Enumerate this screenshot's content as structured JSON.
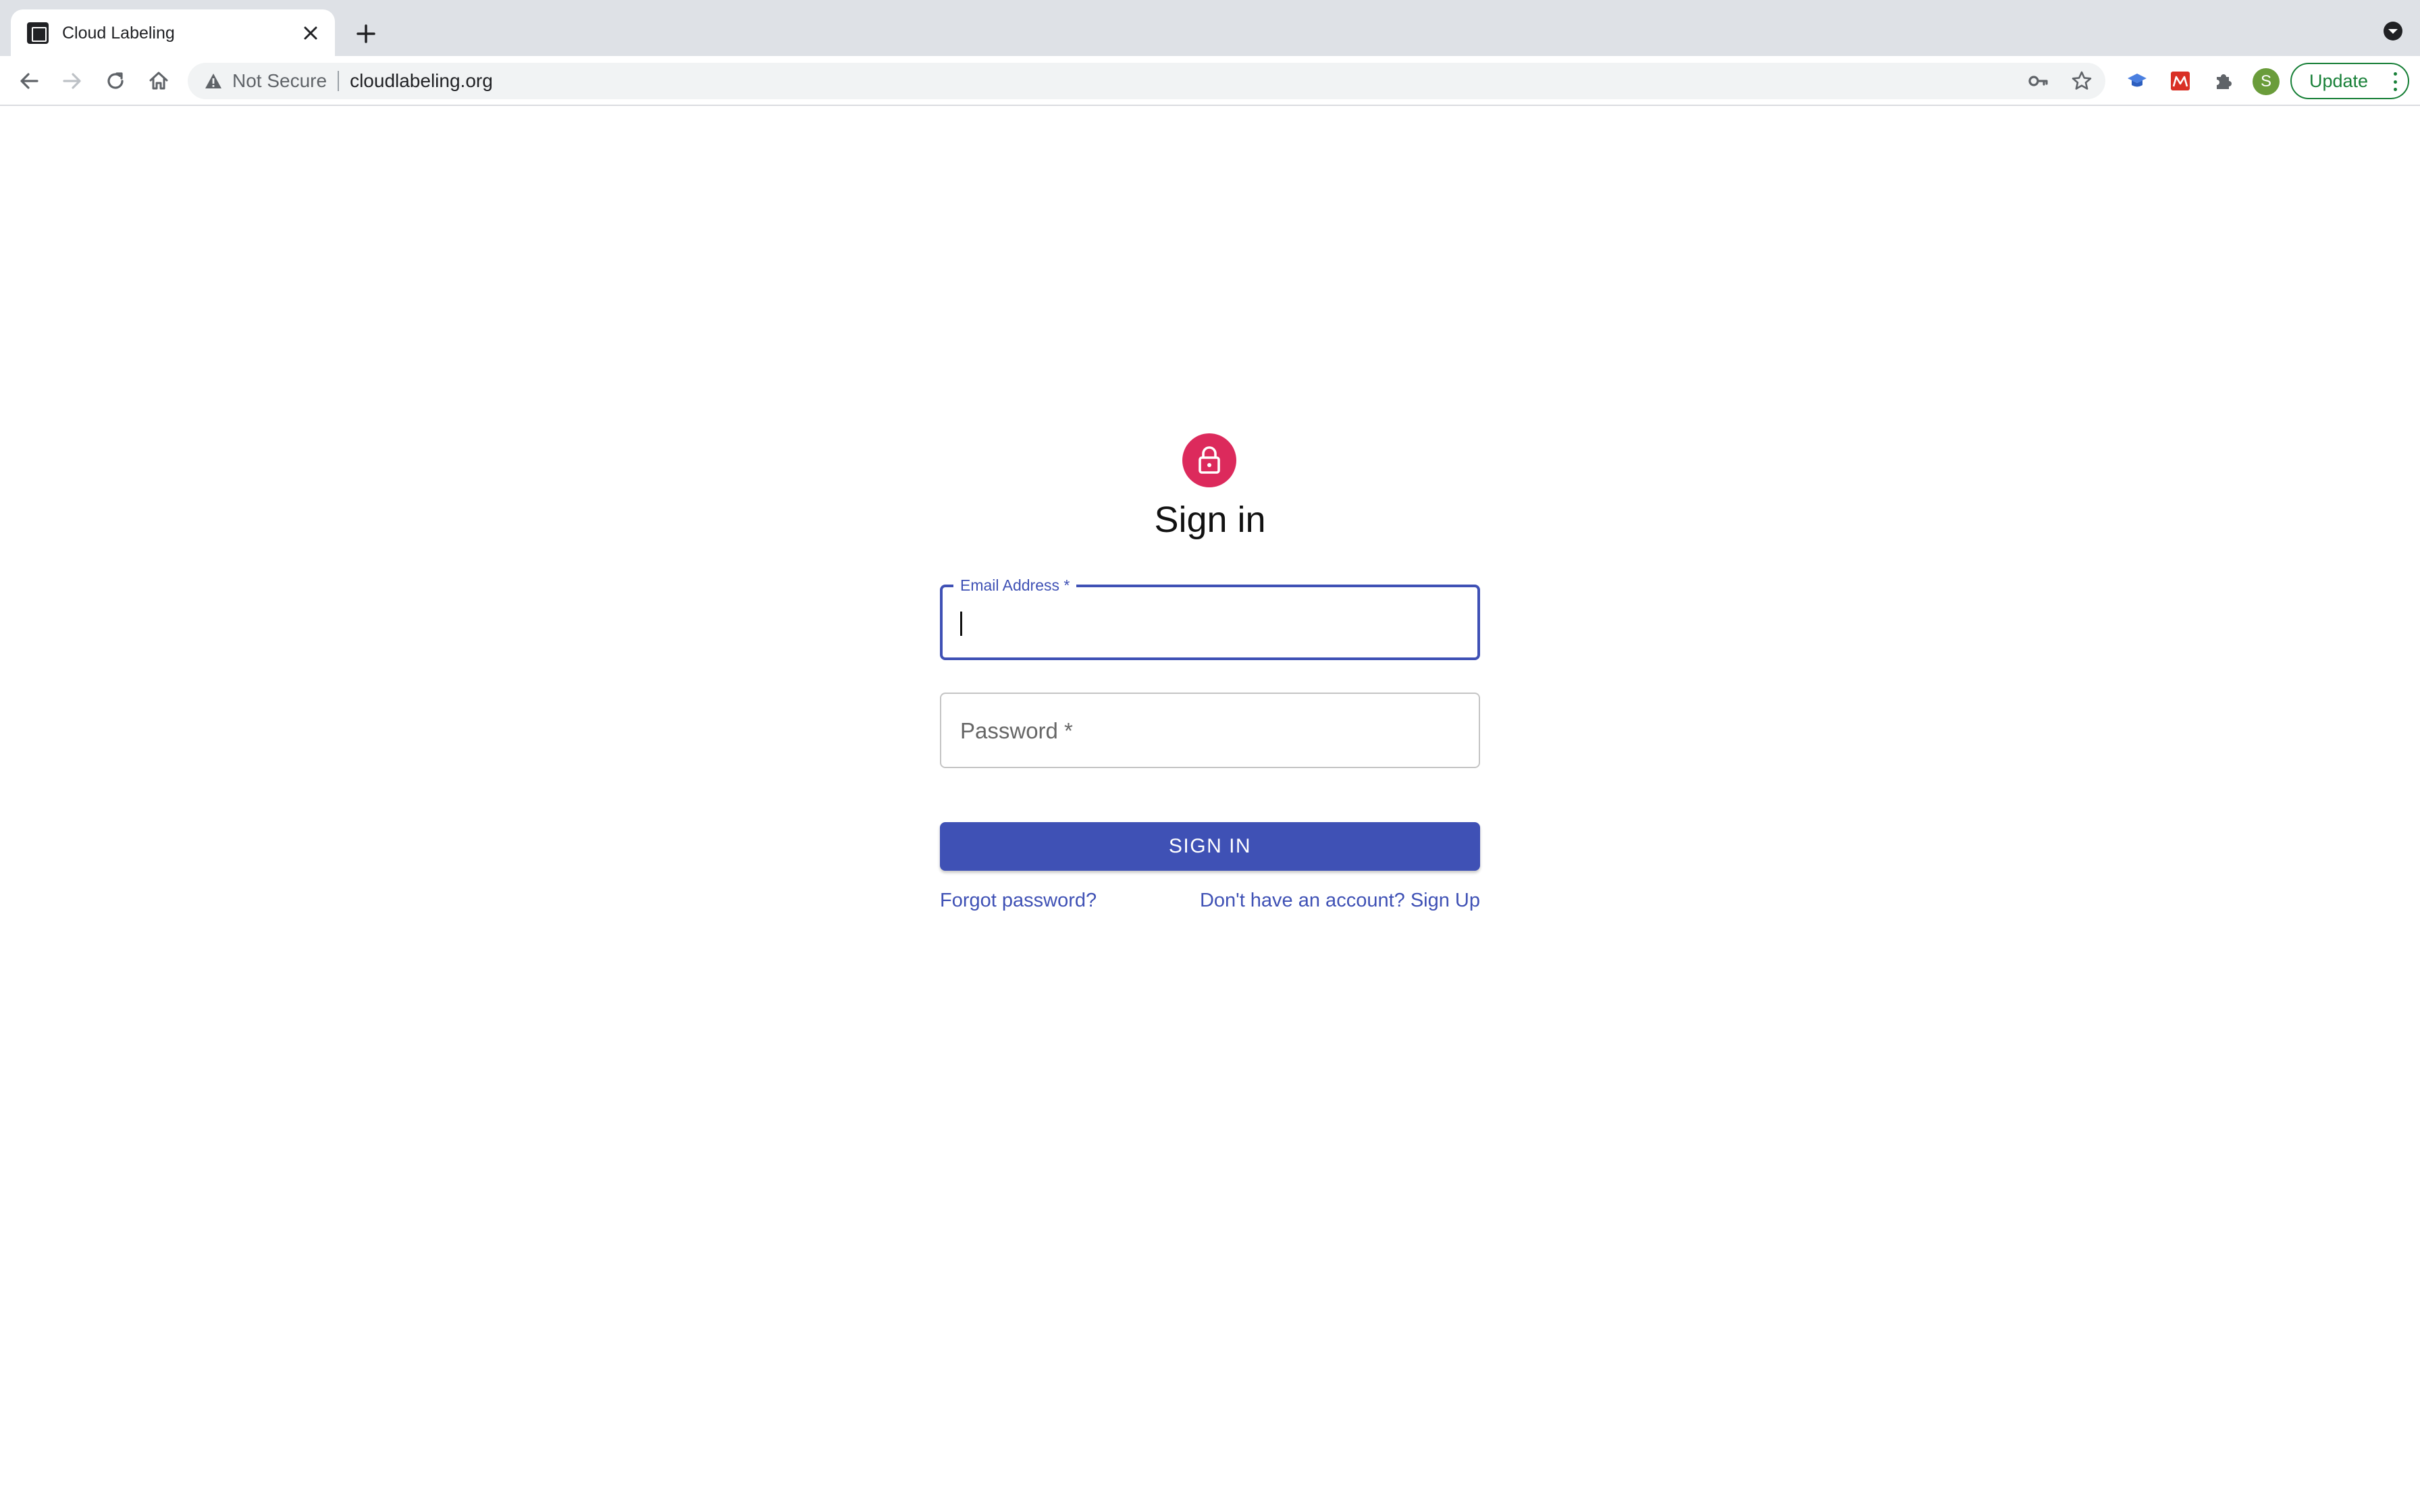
{
  "browser": {
    "tab_title": "Cloud Labeling",
    "security_label": "Not Secure",
    "url": "cloudlabeling.org",
    "profile_initial": "S",
    "update_label": "Update"
  },
  "signin": {
    "title": "Sign in",
    "email_label": "Email Address *",
    "email_value": "",
    "password_placeholder": "Password *",
    "submit_label": "SIGN IN",
    "forgot_link": "Forgot password?",
    "signup_link": "Don't have an account? Sign Up"
  },
  "colors": {
    "primary": "#3f51b5",
    "lock_avatar": "#dc2a5c",
    "update_green": "#188038"
  },
  "icons": {
    "back": "arrow-left-icon",
    "forward": "arrow-right-icon",
    "reload": "reload-icon",
    "home": "home-icon",
    "warning": "warning-triangle-icon",
    "key": "key-icon",
    "bookmark": "star-icon",
    "lock": "lock-icon"
  }
}
